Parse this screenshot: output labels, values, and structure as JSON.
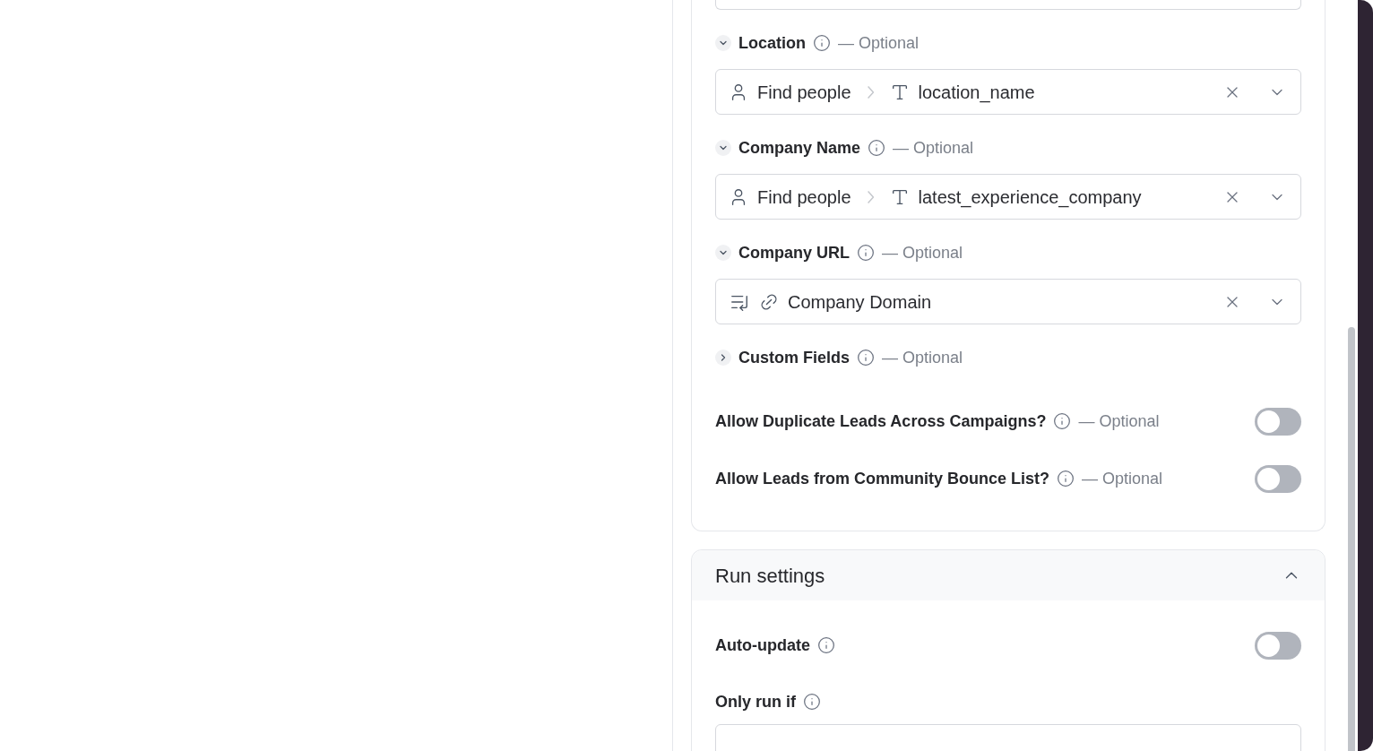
{
  "inputs_card": {
    "fields": [
      {
        "kind": "mapped",
        "label": "Location",
        "expanded": true,
        "optional": "— Optional",
        "value": {
          "kind": "column",
          "source": "Find people",
          "column": "location_name"
        }
      },
      {
        "kind": "mapped",
        "label": "Company Name",
        "expanded": true,
        "optional": "— Optional",
        "value": {
          "kind": "column",
          "source": "Find people",
          "column": "latest_experience_company"
        }
      },
      {
        "kind": "mapped",
        "label": "Company URL",
        "expanded": true,
        "optional": "— Optional",
        "value": {
          "kind": "list",
          "column": "Company Domain"
        }
      },
      {
        "kind": "group",
        "label": "Custom Fields",
        "expanded": false,
        "optional": "— Optional"
      },
      {
        "kind": "toggle",
        "label": "Allow Duplicate Leads Across Campaigns?",
        "optional": "— Optional",
        "on": false
      },
      {
        "kind": "toggle",
        "label": "Allow Leads from Community Bounce List?",
        "optional": "— Optional",
        "on": false
      }
    ]
  },
  "run_settings": {
    "title": "Run settings",
    "expanded": true,
    "items": [
      {
        "kind": "toggle",
        "label": "Auto-update",
        "on": false
      },
      {
        "kind": "condition",
        "label": "Only run if"
      }
    ]
  }
}
